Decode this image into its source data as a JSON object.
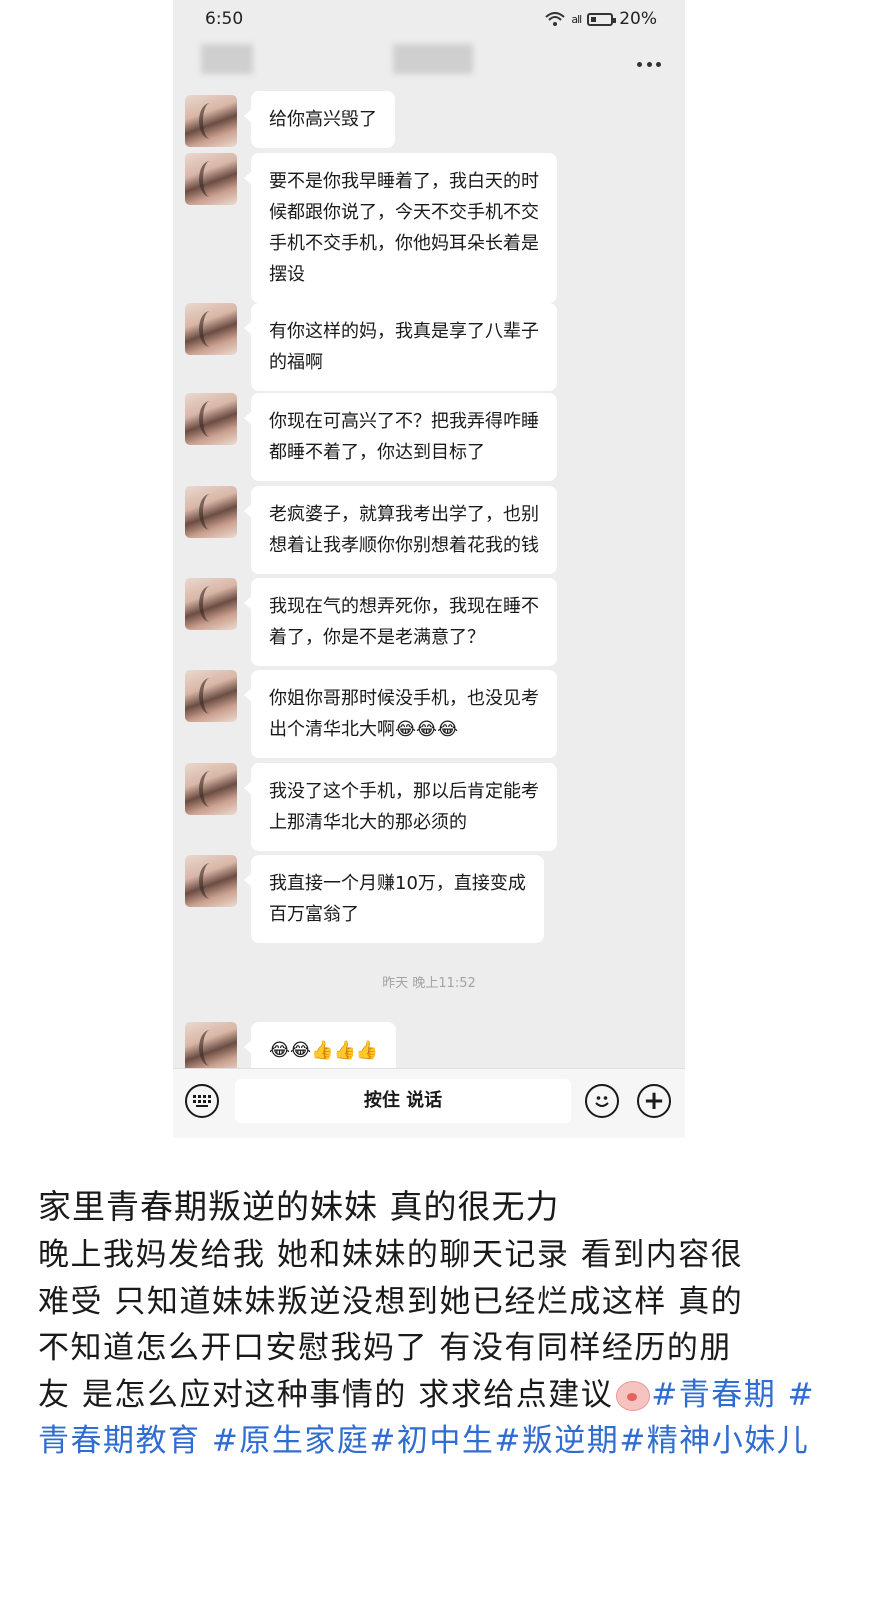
{
  "status_bar": {
    "time": "6:50",
    "signal": "all",
    "battery": "20%"
  },
  "chat": {
    "messages": [
      {
        "text": "给你高兴毁了"
      },
      {
        "text": "要不是你我早睡着了，我白天的时\n候都跟你说了，今天不交手机不交\n手机不交手机，你他妈耳朵长着是\n摆设"
      },
      {
        "text": "有你这样的妈，我真是享了八辈子\n的福啊"
      },
      {
        "text": "你现在可高兴了不？把我弄得咋睡\n都睡不着了，你达到目标了"
      },
      {
        "text": "老疯婆子，就算我考出学了，也别\n想着让我孝顺你你别想着花我的钱"
      },
      {
        "text": "我现在气的想弄死你，我现在睡不\n着了，你是不是老满意了？"
      },
      {
        "text": "你姐你哥那时候没手机，也没见考\n出个清华北大啊😂😂😂"
      },
      {
        "text": "我没了这个手机，那以后肯定能考\n上那清华北大的那必须的"
      },
      {
        "text": "我直接一个月赚10万，直接变成\n百万富翁了"
      },
      {
        "text": "😂😂👍👍👍"
      }
    ],
    "timestamp": "昨天 晚上11:52",
    "input": {
      "voice_label": "按住 说话"
    }
  },
  "post": {
    "title": "家里青春期叛逆的妹妹 真的很无力",
    "body_lines": [
      "晚上我妈发给我 她和妹妹的聊天记录 看到内容很",
      "难受 只知道妹妹叛逆没想到她已经烂成这样 真的",
      "不知道怎么开口安慰我妈了 有没有同样经历的朋",
      "友 是怎么应对这种事情的 求求给点建议"
    ],
    "tags": [
      "#青春期",
      "#青春期教育",
      "#原生家庭",
      "#初中生",
      "#叛逆期",
      "#精神小妹儿"
    ]
  },
  "colors": {
    "tag": "#2f6dd0",
    "chat_bg": "#ededed",
    "bubble": "#ffffff"
  }
}
